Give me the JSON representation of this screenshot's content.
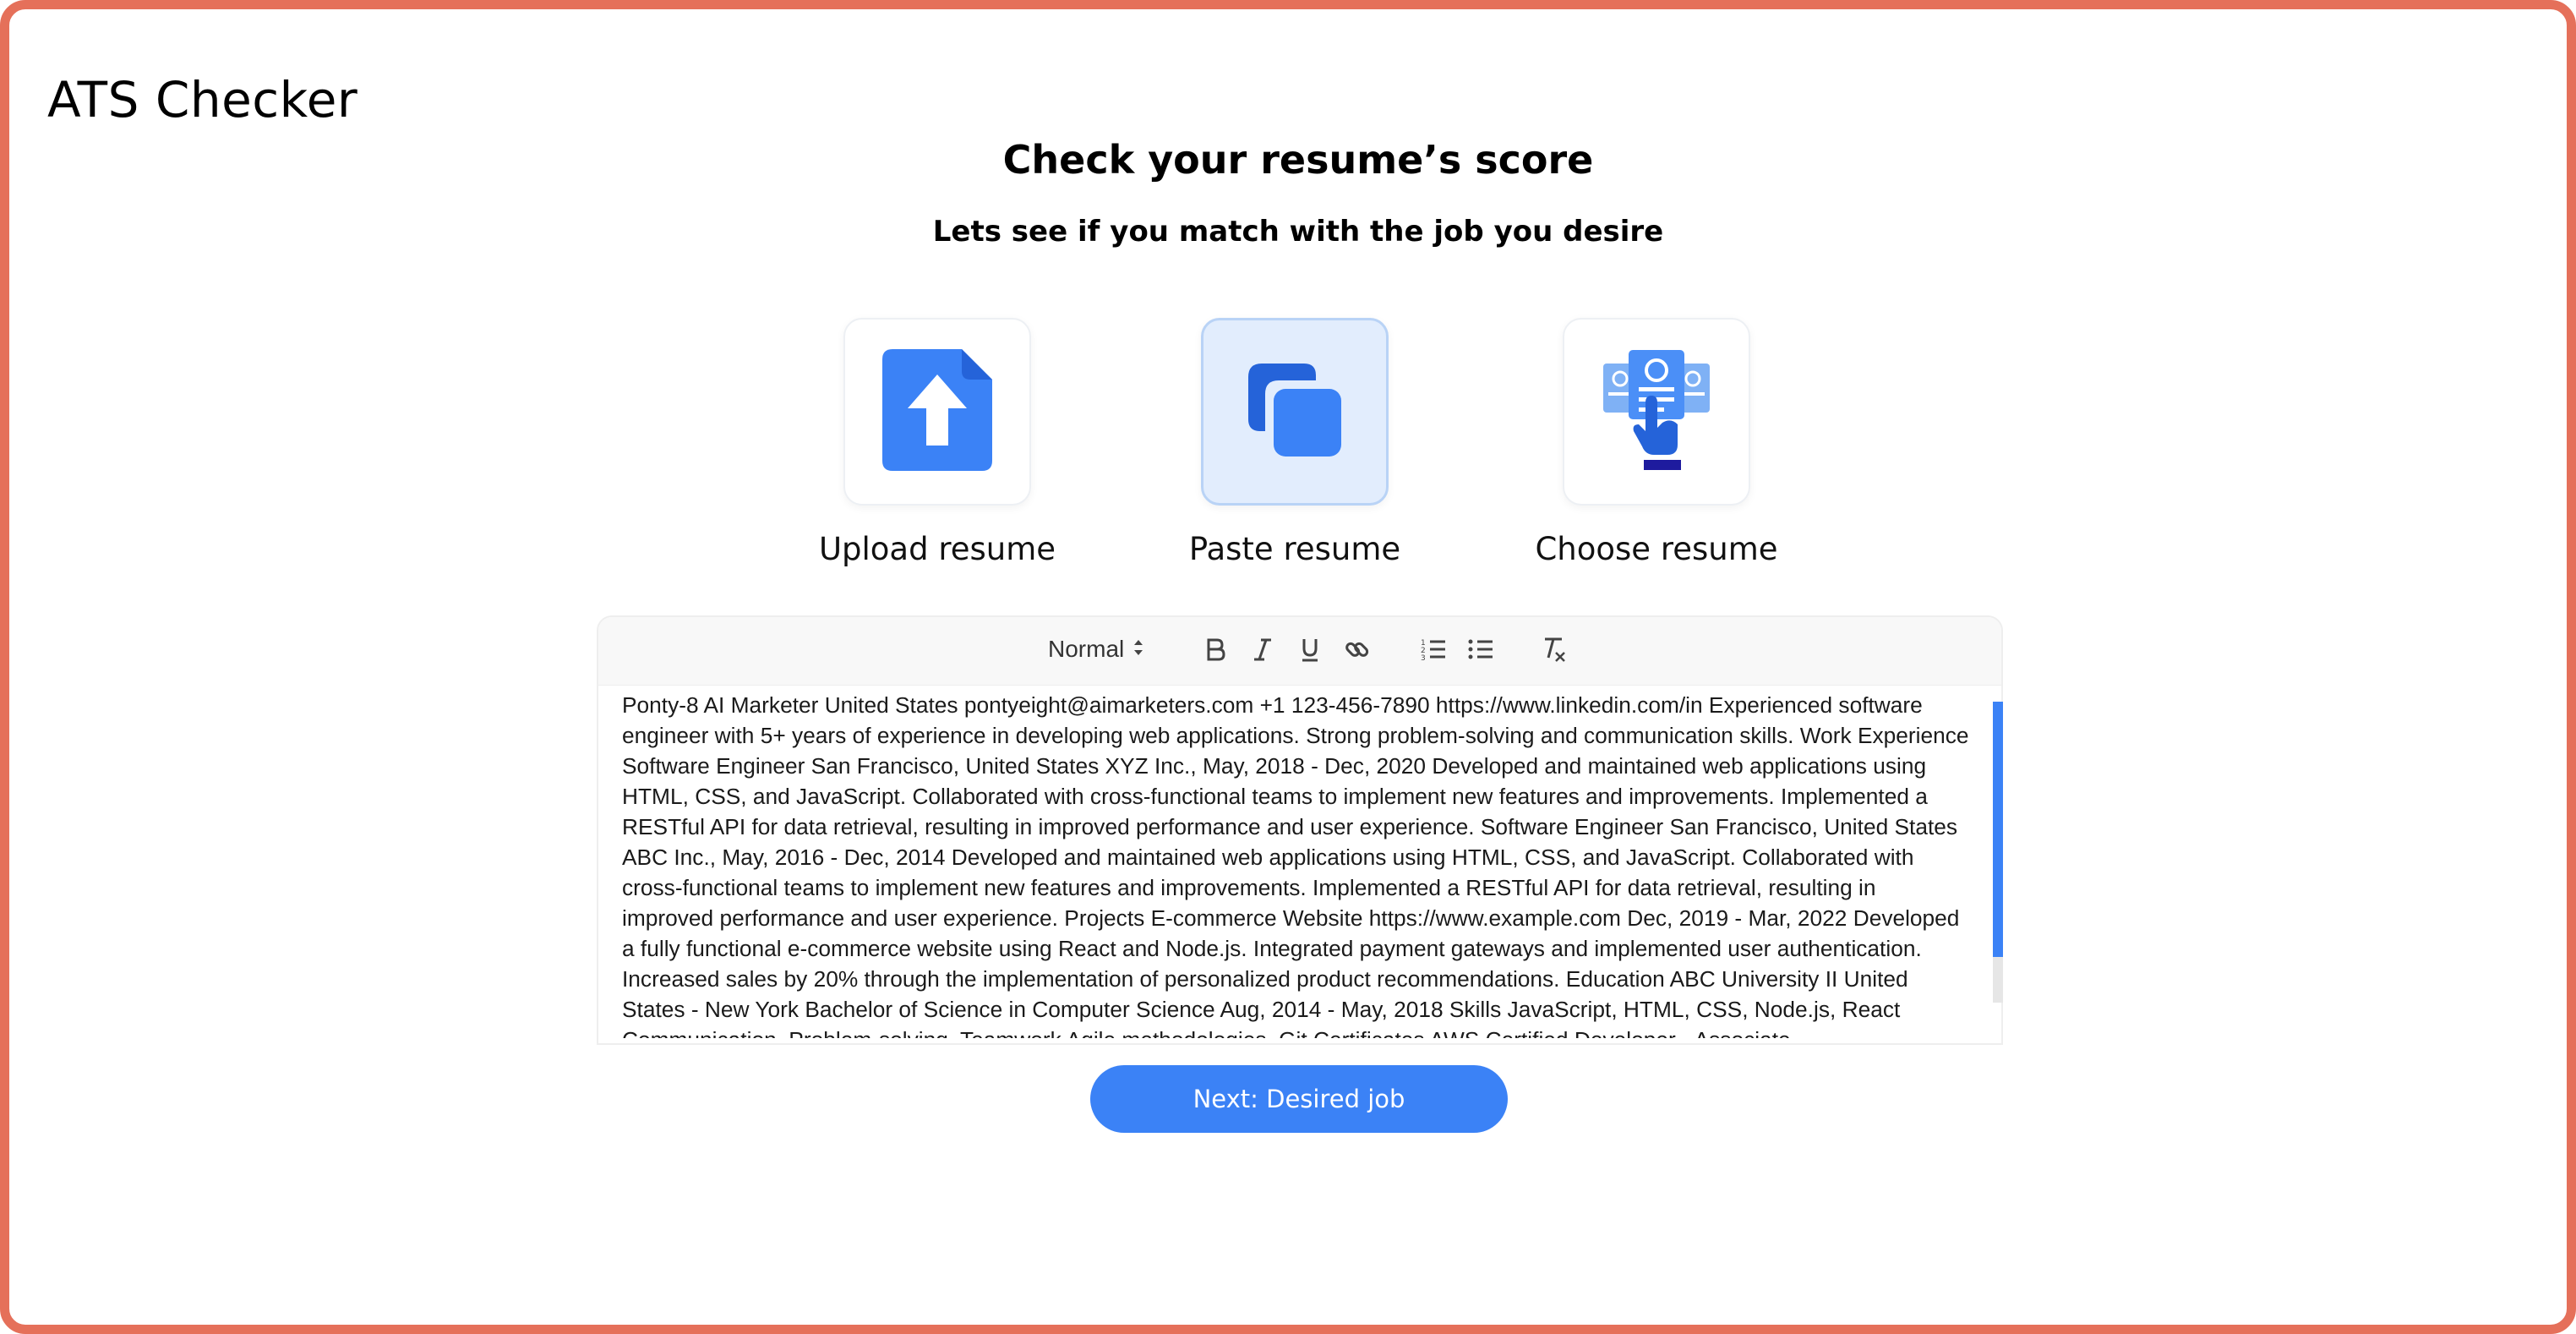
{
  "app": {
    "title": "ATS Checker"
  },
  "header": {
    "heading": "Check your resume’s score",
    "subheading": "Lets see if you match with the job you desire"
  },
  "options": [
    {
      "label": "Upload resume",
      "icon": "upload-file-icon",
      "selected": false
    },
    {
      "label": "Paste resume",
      "icon": "copy-paste-icon",
      "selected": true
    },
    {
      "label": "Choose resume",
      "icon": "choose-resume-icon",
      "selected": false
    }
  ],
  "editor": {
    "format_select": "Normal",
    "toolbar_icons": [
      "bold-icon",
      "italic-icon",
      "underline-icon",
      "link-icon",
      "ordered-list-icon",
      "bullet-list-icon",
      "clear-format-icon"
    ],
    "content": "Ponty-8 AI Marketer United States pontyeight@aimarketers.com +1 123-456-7890 https://www.linkedin.com/in Experienced software engineer with 5+ years of experience in developing web applications. Strong problem-solving and communication skills. Work Experience Software Engineer San Francisco, United States XYZ Inc., May, 2018 - Dec, 2020 Developed and maintained web applications using HTML, CSS, and JavaScript. Collaborated with cross-functional teams to implement new features and improvements. Implemented a RESTful API for data retrieval, resulting in improved performance and user experience. Software Engineer San Francisco, United States ABC Inc., May, 2016 - Dec, 2014 Developed and maintained web applications using HTML, CSS, and JavaScript. Collaborated with cross-functional teams to implement new features and improvements. Implemented a RESTful API for data retrieval, resulting in improved performance and user experience. Projects E-commerce Website https://www.example.com Dec, 2019 - Mar, 2022 Developed a fully functional e-commerce website using React and Node.js. Integrated payment gateways and implemented user authentication. Increased sales by 20% through the implementation of personalized product recommendations. Education ABC University II United States - New York Bachelor of Science in Computer Science Aug, 2014 - May, 2018 Skills JavaScript, HTML, CSS, Node.js, React Communication, Problem-solving, Teamwork Agile methodologies, Git Certificates AWS Certified Developer - Associate"
  },
  "actions": {
    "next_label": "Next: Desired job"
  },
  "colors": {
    "frame_border": "#e5705a",
    "accent": "#3b82f6",
    "selected_bg": "#e2edfd"
  }
}
